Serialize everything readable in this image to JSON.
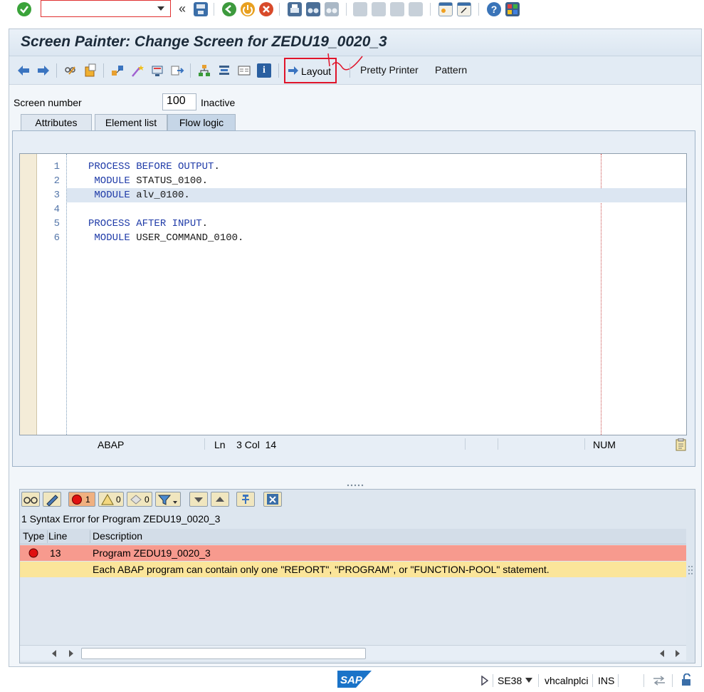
{
  "window": {
    "title": "Screen Painter: Change Screen for ZEDU19_0020_3"
  },
  "system_toolbar": {
    "command_field": {
      "value": "",
      "placeholder": ""
    },
    "icons": [
      "enter-icon",
      "back-double-icon",
      "save-icon",
      "back-icon",
      "exit-icon",
      "cancel-icon",
      "print-icon",
      "find-icon",
      "find-next-icon",
      "first-page-icon",
      "prev-page-icon",
      "next-page-icon",
      "last-page-icon",
      "new-session-icon",
      "shortcut-icon",
      "help-icon",
      "customize-layout-icon"
    ]
  },
  "app_toolbar": {
    "icons": [
      "back-arrow-icon",
      "forward-arrow-icon",
      "display-change-icon",
      "activate-icon",
      "check-icon",
      "where-used-icon",
      "wand-icon",
      "screen-layout-icon",
      "move-icon",
      "hierarchy-icon",
      "stack-icon",
      "display-icon",
      "info-icon"
    ],
    "layout_label": "Layout",
    "pretty_printer_label": "Pretty Printer",
    "pattern_label": "Pattern"
  },
  "screen": {
    "number_label": "Screen number",
    "number_value": "100",
    "status": "Inactive"
  },
  "tabs": [
    {
      "label": "Attributes"
    },
    {
      "label": "Element list"
    },
    {
      "label": "Flow logic",
      "active": true
    }
  ],
  "editor": {
    "lines": [
      {
        "num": "1",
        "kw": "PROCESS BEFORE OUTPUT",
        "rest": "."
      },
      {
        "num": "2",
        "kw": " MODULE",
        "rest": " STATUS_0100."
      },
      {
        "num": "3",
        "kw": " MODULE",
        "rest": " alv_0100.",
        "highlight": true
      },
      {
        "num": "4",
        "kw": "",
        "rest": ""
      },
      {
        "num": "5",
        "kw": "PROCESS AFTER INPUT",
        "rest": "."
      },
      {
        "num": "6",
        "kw": " MODULE",
        "rest": " USER_COMMAND_0100."
      }
    ],
    "status": {
      "language": "ABAP",
      "position": "Ln    3 Col  14",
      "mode": "NUM"
    }
  },
  "error_panel": {
    "counts": {
      "errors": "1",
      "warnings": "0",
      "infos": "0"
    },
    "title": "1 Syntax Error for Program ZEDU19_0020_3",
    "columns": [
      "Type",
      "Line",
      "Description"
    ],
    "rows": [
      {
        "type": "error",
        "line": "13",
        "description": "Program ZEDU19_0020_3"
      },
      {
        "type": "",
        "line": "",
        "description": "Each ABAP program can contain only one \"REPORT\", \"PROGRAM\", or \"FUNCTION-POOL\" statement."
      }
    ]
  },
  "status_bar": {
    "logo": "SAP",
    "transaction": "SE38",
    "server": "vhcalnplci",
    "insert_mode": "INS"
  },
  "colors": {
    "title_bg": "#dbe6f1",
    "keyword": "#1f3ba8",
    "error_row": "#f79a8e",
    "hint_row": "#fbe59a",
    "highlight_box": "#e0142a"
  }
}
